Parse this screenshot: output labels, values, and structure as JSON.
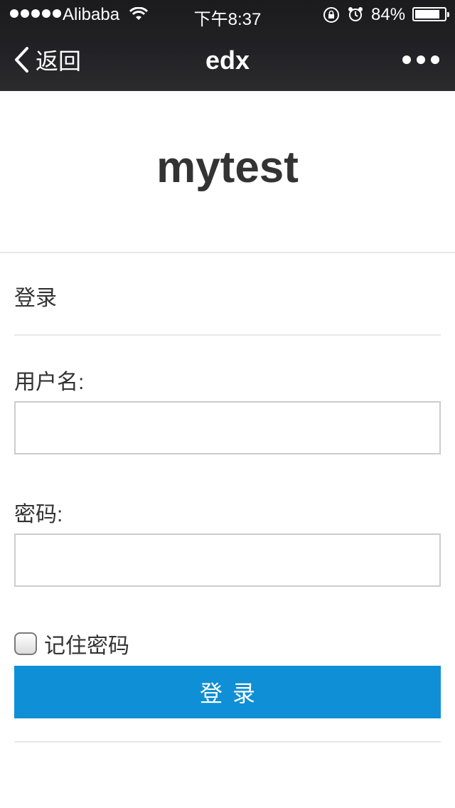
{
  "status_bar": {
    "carrier": "Alibaba",
    "time": "下午8:37",
    "battery_percent": "84%",
    "battery_level": 0.84,
    "icons": [
      "signal-dots-icon",
      "wifi-icon",
      "rotation-lock-icon",
      "alarm-icon",
      "battery-icon"
    ]
  },
  "nav": {
    "back_label": "返回",
    "title": "edx",
    "more_icon": "more-dots-icon"
  },
  "page": {
    "site_title": "mytest",
    "section_title": "登录",
    "username_label": "用户名:",
    "username_value": "",
    "password_label": "密码:",
    "password_value": "",
    "remember_label": "记住密码",
    "remember_checked": false,
    "submit_label": "登录"
  },
  "colors": {
    "topbar": "#1b1b1d",
    "primary_button": "#0f8fd5",
    "text": "#333333",
    "divider": "#e8e8e8"
  }
}
